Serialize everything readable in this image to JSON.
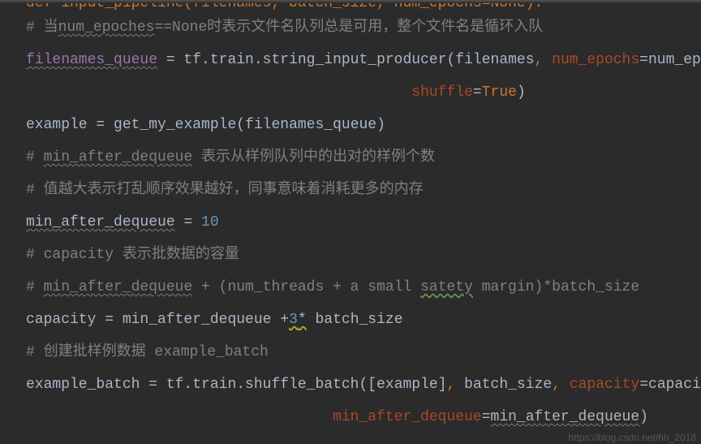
{
  "top_partial": "def input_pipeline(filenames, batch_size, num_epochs=None):",
  "lines": {
    "l1_comment_pre": "# 当",
    "l1_comment_mid": "num_epoches",
    "l1_comment_post": "==None时表示文件名队列总是可用，整个文件名是循环入队",
    "l2_var": "filenames_queue",
    "l2_assign": " = tf.train.",
    "l2_func": "string_input_producer",
    "l2_open": "(",
    "l2_arg1": "filenames",
    "l2_comma1": ", ",
    "l2_kw1": "num_epochs",
    "l2_eq1": "=",
    "l2_val1": "num_epochs",
    "l2_comma2": ",",
    "l3_pad": "                                            ",
    "l3_kw": "shuffle",
    "l3_eq": "=",
    "l3_val": "True",
    "l3_close": ")",
    "l4_lhs": "example = ",
    "l4_func": "get_my_example",
    "l4_open": "(",
    "l4_arg": "filenames_queue",
    "l4_close": ")",
    "l5_c_pre": "# ",
    "l5_c_u": "min_after_dequeue",
    "l5_c_post": " 表示从样例队列中的出对的样例个数",
    "l6_c": "# 值越大表示打乱顺序效果越好，同事意味着消耗更多的内存",
    "l7_var": "min_after_dequeue",
    "l7_assign": " = ",
    "l7_num": "10",
    "l8_c": "# capacity 表示批数据的容量",
    "l9_c_pre": "# ",
    "l9_c_u1": "min_after_dequeue",
    "l9_c_mid": " + (num_threads + a small ",
    "l9_c_u2": "satety",
    "l9_c_post": " margin)*batch_size",
    "l10_lhs": "capacity = min_after_dequeue +",
    "l10_num": "3",
    "l10_star": "*",
    "l10_rhs": " batch_size",
    "l11_c": "# 创建批样例数据 example_batch",
    "l12_lhs": "example_batch = tf.train.",
    "l12_func": "shuffle_batch",
    "l12_open": "(",
    "l12_br": "[",
    "l12_arg": "example",
    "l12_br2": "]",
    "l12_comma1": ", ",
    "l12_arg2": "batch_size",
    "l12_comma2": ", ",
    "l12_kw1": "capacity",
    "l12_eq1": "=",
    "l12_val1": "capacity",
    "l12_comma3": ",",
    "l13_pad": "                                   ",
    "l13_kw": "min_after_dequeue",
    "l13_eq": "=",
    "l13_val": "min_after_dequeue",
    "l13_close": ")"
  },
  "watermark": "https://blog.csdn.net/hh_2018"
}
